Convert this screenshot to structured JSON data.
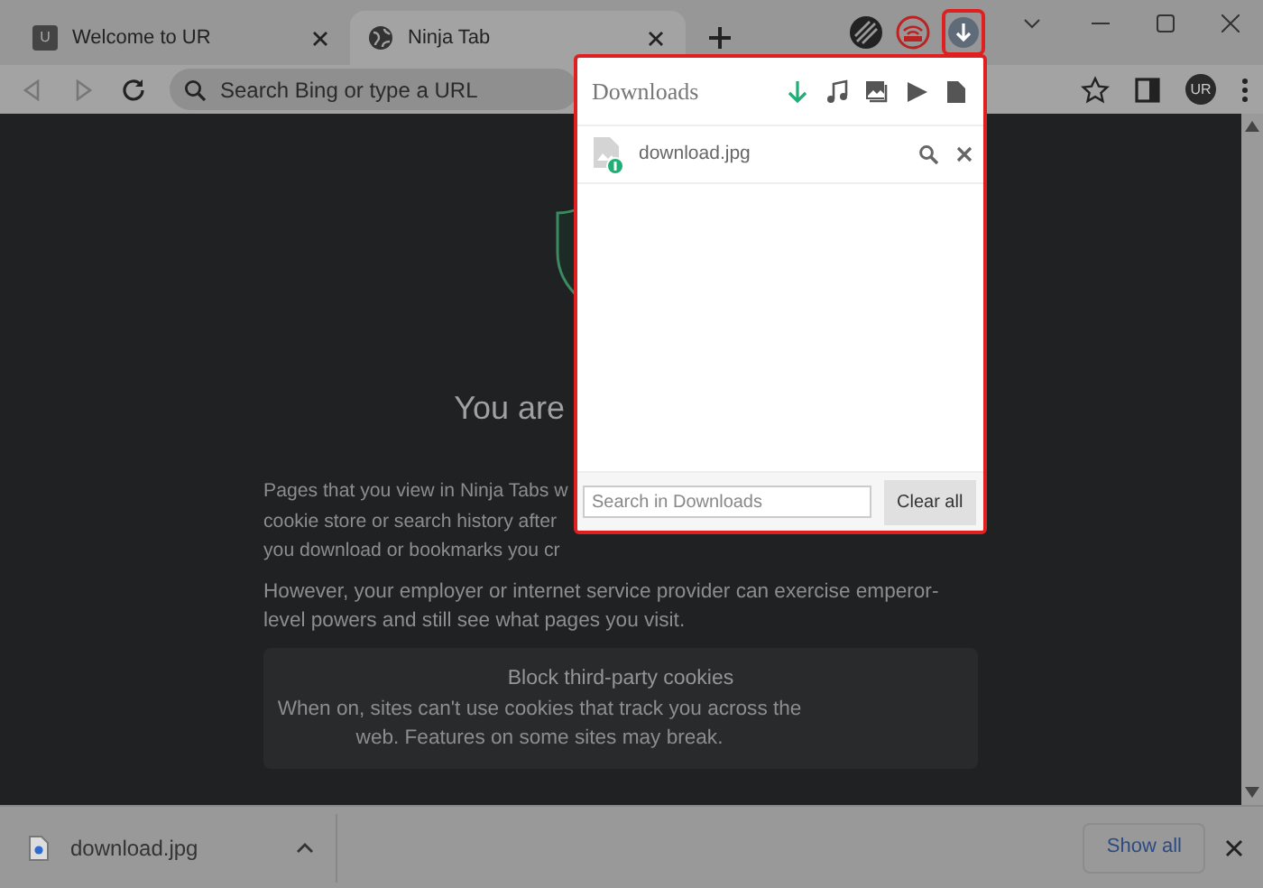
{
  "tabs": [
    {
      "title": "Welcome to UR",
      "kind": "letter",
      "favicon_letter": "U",
      "selected": false
    },
    {
      "title": "Ninja Tab",
      "kind": "globe",
      "selected": true
    }
  ],
  "address_bar": {
    "placeholder": "Search Bing or type a URL"
  },
  "profile": {
    "initials": "UR"
  },
  "page": {
    "heading": "You are",
    "paragraph_lines": [
      "Pages that you view in Ninja Tabs w",
      "cookie store or search history after",
      "you download or bookmarks you cr"
    ],
    "paragraph_2": "However, your employer or internet service provider can exercise emperor-level powers and still see what pages you visit.",
    "cookie_title": "Block third-party cookies",
    "cookie_text": "When on, sites can't use cookies that track you across the web. Features on some sites may break."
  },
  "downloads_popup": {
    "title": "Downloads",
    "filters": [
      {
        "kind": "all",
        "selected": true
      },
      {
        "kind": "audio",
        "selected": false
      },
      {
        "kind": "image",
        "selected": false
      },
      {
        "kind": "video",
        "selected": false
      },
      {
        "kind": "document",
        "selected": false
      }
    ],
    "items": [
      {
        "name": "download.jpg"
      }
    ],
    "search_placeholder": "Search in Downloads",
    "clear_button": "Clear all"
  },
  "download_bar": {
    "items": [
      {
        "name": "download.jpg"
      }
    ],
    "show_all": "Show all"
  }
}
